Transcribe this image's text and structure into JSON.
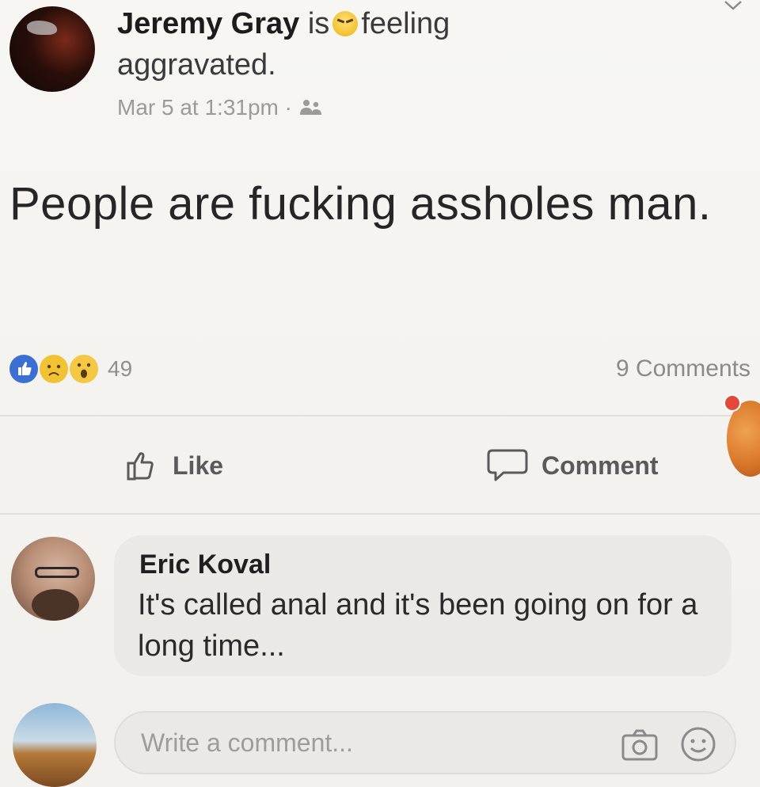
{
  "post": {
    "author": "Jeremy Gray",
    "is_word": "is",
    "feeling_word": "feeling",
    "feeling_value": "aggravated.",
    "timestamp": "Mar 5 at 1:31pm",
    "separator": "·",
    "privacy_icon": "friends-icon",
    "body": "People are fucking assholes man.",
    "reactions_count": "49",
    "reaction_icons": [
      "like-reaction-icon",
      "sad-reaction-icon",
      "wow-reaction-icon"
    ],
    "comments_count": "9 Comments"
  },
  "actions": {
    "like_label": "Like",
    "comment_label": "Comment"
  },
  "comment": {
    "author": "Eric Koval",
    "text": "It's called anal and it's been going on for a long time..."
  },
  "composer": {
    "placeholder": "Write a comment..."
  },
  "colors": {
    "like_blue": "#3b6fd4",
    "reaction_yellow": "#f1c232",
    "bubble_bg": "#ebe9e5",
    "text_muted": "#9a9a9a"
  }
}
